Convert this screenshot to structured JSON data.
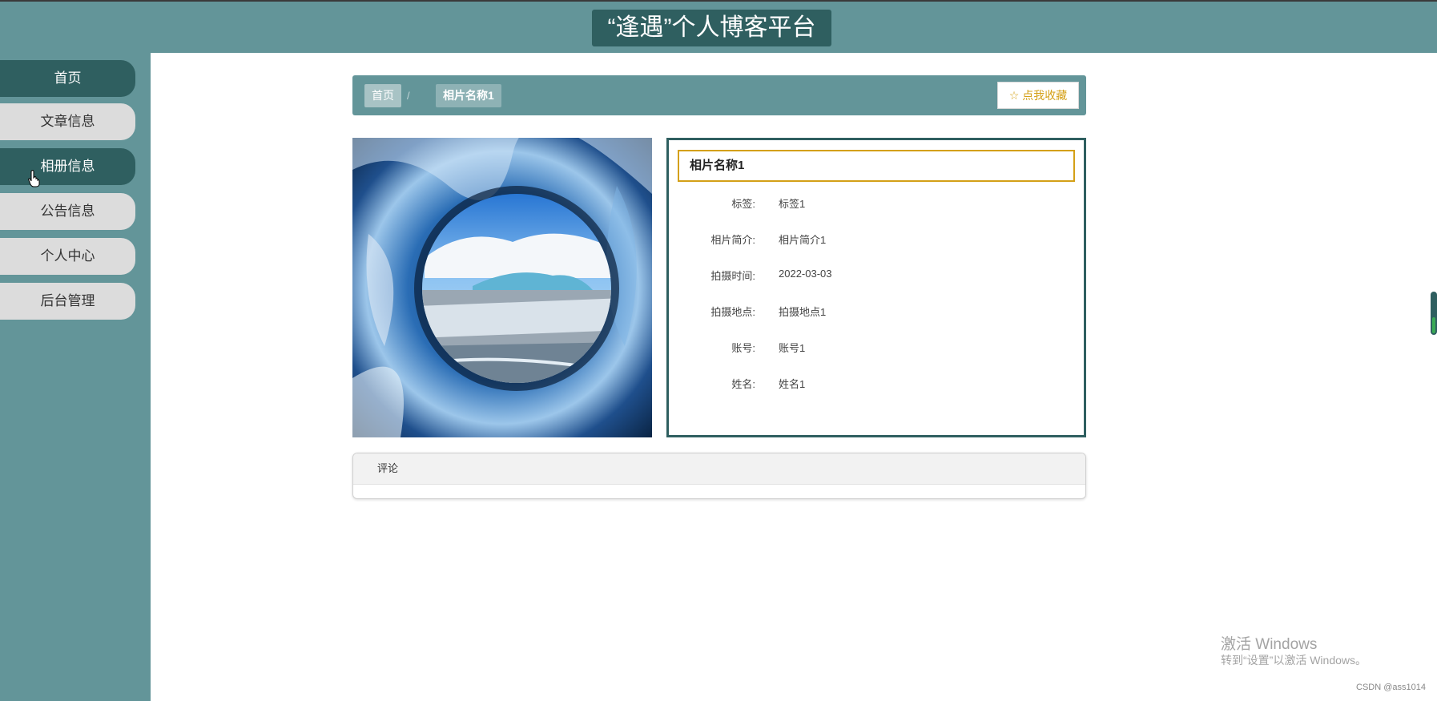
{
  "header": {
    "title": "“逢遇”个人博客平台"
  },
  "sidebar": {
    "items": [
      {
        "label": "首页",
        "active": true
      },
      {
        "label": "文章信息",
        "active": false
      },
      {
        "label": "相册信息",
        "active": true
      },
      {
        "label": "公告信息",
        "active": false
      },
      {
        "label": "个人中心",
        "active": false
      },
      {
        "label": "后台管理",
        "active": false
      }
    ]
  },
  "breadcrumb": {
    "home": "首页",
    "separator": "/",
    "current": "相片名称1"
  },
  "favorite": {
    "icon": "star-outline-icon",
    "label": "点我收藏"
  },
  "detail": {
    "title": "相片名称1",
    "fields": [
      {
        "label": "标签:",
        "value": "标签1"
      },
      {
        "label": "相片简介:",
        "value": "相片简介1"
      },
      {
        "label": "拍摄时间:",
        "value": "2022-03-03"
      },
      {
        "label": "拍摄地点:",
        "value": "拍摄地点1"
      },
      {
        "label": "账号:",
        "value": "账号1"
      },
      {
        "label": "姓名:",
        "value": "姓名1"
      }
    ]
  },
  "comments": {
    "title": "评论"
  },
  "watermark": {
    "line1": "激活 Windows",
    "line2": "转到“设置”以激活 Windows。"
  },
  "credit": "CSDN @ass1014",
  "colors": {
    "primary": "#639599",
    "primary_dark": "#2f5f60",
    "accent_gold": "#d4a017",
    "nav_inactive": "#dcdcdc"
  }
}
